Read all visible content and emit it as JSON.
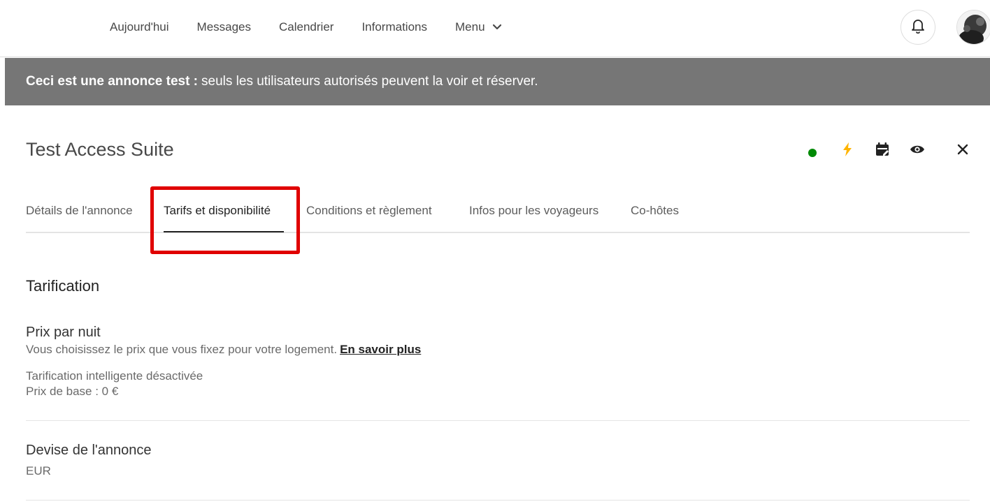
{
  "nav": {
    "links": [
      "Aujourd'hui",
      "Messages",
      "Calendrier",
      "Informations"
    ],
    "menu_label": "Menu"
  },
  "banner": {
    "bold": "Ceci est une annonce test :",
    "text": "seuls les utilisateurs autorisés peuvent la voir et réserver."
  },
  "listing": {
    "title": "Test Access Suite",
    "status_color": "#008a05",
    "instant_book_color": "#ffb400"
  },
  "tabs": [
    "Détails de l'annonce",
    "Tarifs et disponibilité",
    "Conditions et règlement",
    "Infos pour les voyageurs",
    "Co-hôtes"
  ],
  "active_tab": "Tarifs et disponibilité",
  "pricing": {
    "section_title": "Tarification",
    "nightly": {
      "title": "Prix par nuit",
      "desc": "Vous choisissez le prix que vous fixez pour votre logement.",
      "link": "En savoir plus",
      "smart_pricing": "Tarification intelligente désactivée",
      "base_price": "Prix de base : 0 €"
    },
    "currency": {
      "title": "Devise de l'annonce",
      "value": "EUR"
    }
  },
  "highlight_color": "#e00000"
}
